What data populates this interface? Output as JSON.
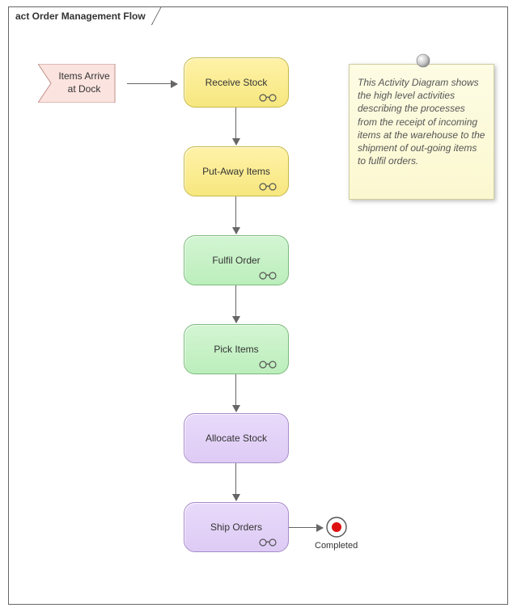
{
  "frame": {
    "title": "act Order Management Flow"
  },
  "event": {
    "label": "Items Arrive at Dock"
  },
  "activities": [
    {
      "label": "Receive Stock"
    },
    {
      "label": "Put-Away Items"
    },
    {
      "label": "Fulfil Order"
    },
    {
      "label": "Pick Items"
    },
    {
      "label": "Allocate Stock"
    },
    {
      "label": "Ship Orders"
    }
  ],
  "note": {
    "text": "This Activity Diagram shows the high level activities describing the processes from the receipt of incoming items at the warehouse to the shipment of out-going items to fulfil orders."
  },
  "final": {
    "label": "Completed"
  },
  "colors": {
    "yellow": "#f7e77f",
    "green": "#bceebc",
    "purple": "#decbf5",
    "note": "#fbf8d0",
    "event": "#f7d7d2"
  }
}
